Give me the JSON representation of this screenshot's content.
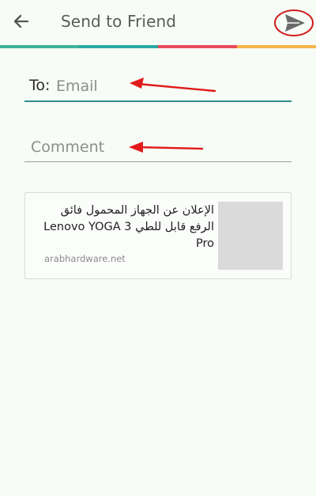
{
  "appbar": {
    "title": "Send to Friend",
    "back_icon": "arrow-left-icon",
    "send_icon": "send-icon"
  },
  "strip_colors": [
    "#3cb39b",
    "#2aa9a3",
    "#e94b58",
    "#f6b54b"
  ],
  "form": {
    "to_label": "To:",
    "to_placeholder": "Email",
    "to_value": "",
    "comment_placeholder": "Comment",
    "comment_value": ""
  },
  "article": {
    "title": "الإعلان عن الجهاز المحمول فائق الرفع قابل للطي Lenovo YOGA 3 Pro",
    "source": "arabhardware.net"
  }
}
